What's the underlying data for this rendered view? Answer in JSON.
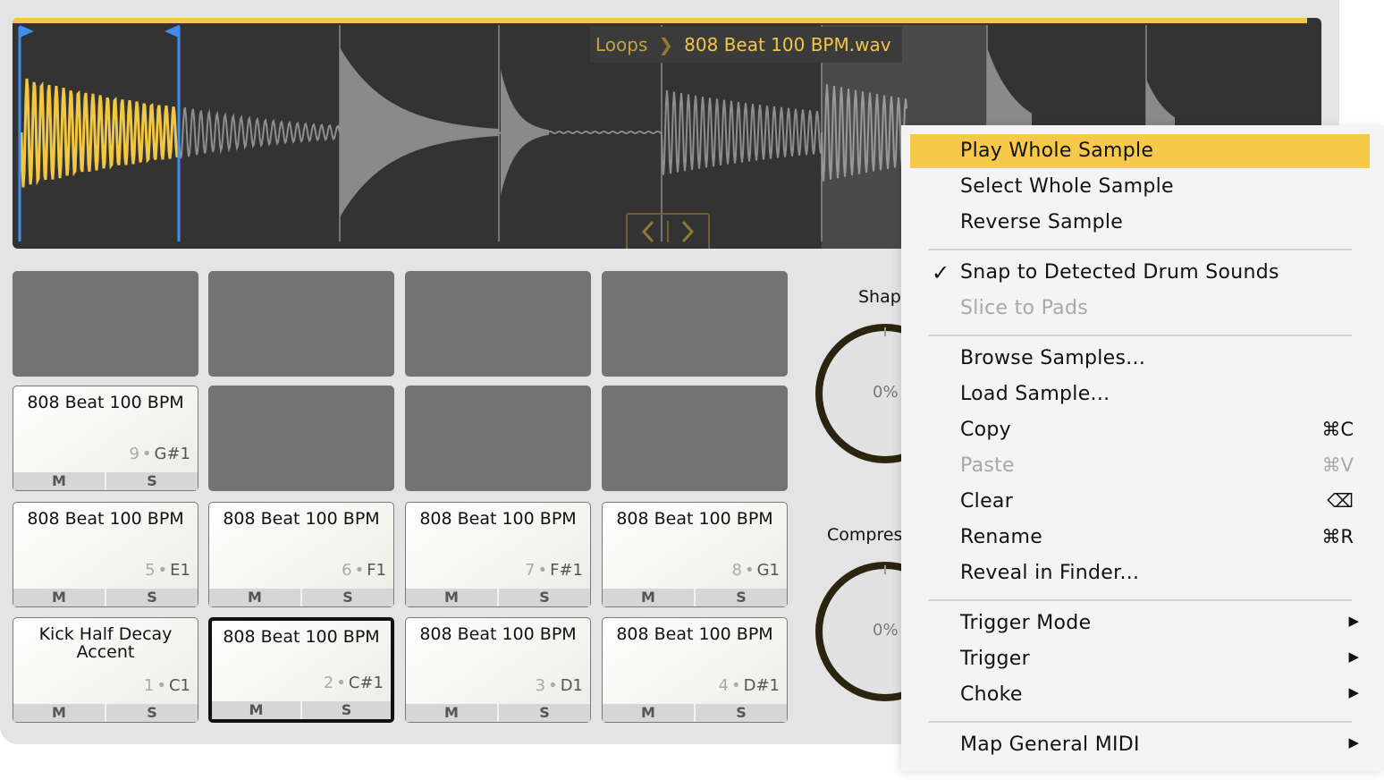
{
  "breadcrumb": {
    "folder": "Loops",
    "file": "808 Beat 100 BPM.wav"
  },
  "pads": [
    {
      "row": 0,
      "col": 0,
      "empty": true
    },
    {
      "row": 0,
      "col": 1,
      "empty": true
    },
    {
      "row": 0,
      "col": 2,
      "empty": true
    },
    {
      "row": 0,
      "col": 3,
      "empty": true
    },
    {
      "row": 1,
      "col": 0,
      "empty": false,
      "name": "808 Beat 100 BPM",
      "num": "9",
      "note": "G#1"
    },
    {
      "row": 1,
      "col": 1,
      "empty": true
    },
    {
      "row": 1,
      "col": 2,
      "empty": true
    },
    {
      "row": 1,
      "col": 3,
      "empty": true
    },
    {
      "row": 2,
      "col": 0,
      "empty": false,
      "name": "808 Beat 100 BPM",
      "num": "5",
      "note": "E1"
    },
    {
      "row": 2,
      "col": 1,
      "empty": false,
      "name": "808 Beat 100 BPM",
      "num": "6",
      "note": "F1"
    },
    {
      "row": 2,
      "col": 2,
      "empty": false,
      "name": "808 Beat 100 BPM",
      "num": "7",
      "note": "F#1"
    },
    {
      "row": 2,
      "col": 3,
      "empty": false,
      "name": "808 Beat 100 BPM",
      "num": "8",
      "note": "G1"
    },
    {
      "row": 3,
      "col": 0,
      "empty": false,
      "name": "Kick Half Decay Accent",
      "num": "1",
      "note": "C1"
    },
    {
      "row": 3,
      "col": 1,
      "empty": false,
      "name": "808 Beat 100 BPM",
      "num": "2",
      "note": "C#1",
      "selected": true
    },
    {
      "row": 3,
      "col": 2,
      "empty": false,
      "name": "808 Beat 100 BPM",
      "num": "3",
      "note": "D1"
    },
    {
      "row": 3,
      "col": 3,
      "empty": false,
      "name": "808 Beat 100 BPM",
      "num": "4",
      "note": "D#1"
    }
  ],
  "pad_buttons": {
    "mute": "M",
    "solo": "S"
  },
  "knobs": [
    {
      "label": "Shap",
      "value": "0%"
    },
    {
      "label": "Compres",
      "value": "0%"
    }
  ],
  "menu": {
    "items": [
      {
        "label": "Play Whole Sample",
        "highlighted": true
      },
      {
        "label": "Select Whole Sample"
      },
      {
        "label": "Reverse Sample"
      },
      {
        "separator": true
      },
      {
        "label": "Snap to Detected Drum Sounds",
        "checked": true,
        "check": "✓"
      },
      {
        "label": "Slice to Pads",
        "disabled": true
      },
      {
        "separator": true
      },
      {
        "label": "Browse Samples..."
      },
      {
        "label": "Load Sample..."
      },
      {
        "label": "Copy",
        "shortcut": "⌘C"
      },
      {
        "label": "Paste",
        "shortcut": "⌘V",
        "disabled": true
      },
      {
        "label": "Clear",
        "shortcut": "⌫"
      },
      {
        "label": "Rename",
        "shortcut": "⌘R"
      },
      {
        "label": "Reveal in Finder..."
      },
      {
        "separator": true
      },
      {
        "label": "Trigger Mode",
        "submenu": true
      },
      {
        "label": "Trigger",
        "submenu": true
      },
      {
        "label": "Choke",
        "submenu": true
      },
      {
        "separator": true
      },
      {
        "label": "Map General MIDI",
        "submenu": true
      }
    ]
  },
  "colors": {
    "accent": "#f2c744",
    "selection_marker": "#3d8ef0",
    "waveform_bg": "#333333",
    "menu_highlight": "#f7c948"
  },
  "icons": {
    "submenu": "triangle-right-icon",
    "check": "checkmark-icon"
  }
}
